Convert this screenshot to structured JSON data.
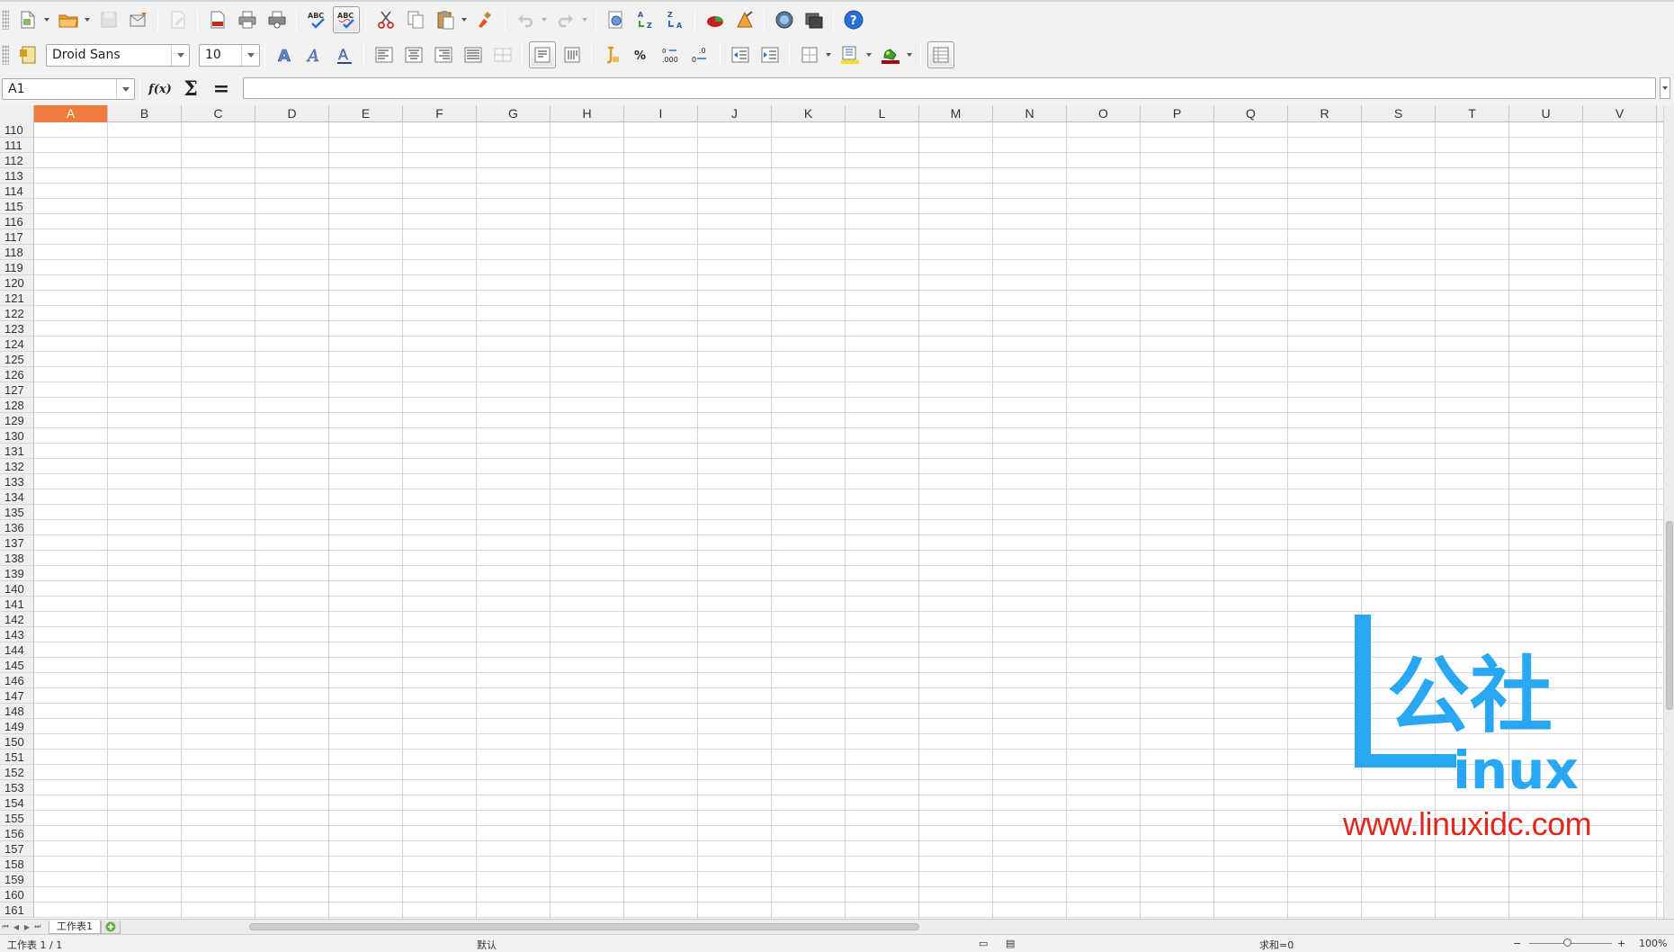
{
  "app": {
    "name_box": "A1",
    "formula": ""
  },
  "toolbar1": {
    "icons": [
      "new-document-icon",
      "open-folder-icon",
      "save-icon",
      "email-icon",
      "edit-mode-icon",
      "export-pdf-icon",
      "print-icon",
      "print-preview-icon",
      "spellcheck-icon",
      "autospellcheck-icon",
      "cut-icon",
      "copy-icon",
      "paste-icon",
      "clone-formatting-icon",
      "undo-icon",
      "redo-icon",
      "navigator-icon",
      "sort-ascending-icon",
      "sort-descending-icon",
      "chart-icon",
      "draw-icon",
      "gallery-icon",
      "data-sources-icon",
      "help-icon"
    ]
  },
  "toolbar2": {
    "font_name": "Droid Sans",
    "font_size": "10",
    "percent_label": "%",
    "decimal_label": ".000",
    "del_decimal_label": ".0"
  },
  "formula_bar": {
    "func_label": "f(x)",
    "sum_label": "Σ",
    "equals_label": "="
  },
  "columns": [
    "A",
    "B",
    "C",
    "D",
    "E",
    "F",
    "G",
    "H",
    "I",
    "J",
    "K",
    "L",
    "M",
    "N",
    "O",
    "P",
    "Q",
    "R",
    "S",
    "T",
    "U",
    "V"
  ],
  "rows": [
    "110",
    "111",
    "112",
    "113",
    "114",
    "115",
    "116",
    "117",
    "118",
    "119",
    "120",
    "121",
    "122",
    "123",
    "124",
    "125",
    "126",
    "127",
    "128",
    "129",
    "130",
    "131",
    "132",
    "133",
    "134",
    "135",
    "136",
    "137",
    "138",
    "139",
    "140",
    "141",
    "142",
    "143",
    "144",
    "145",
    "146",
    "147",
    "148",
    "149",
    "150",
    "151",
    "152",
    "153",
    "154",
    "155",
    "156",
    "157",
    "158",
    "159",
    "160",
    "161"
  ],
  "selected_column": "A",
  "sheets": [
    {
      "label": "工作表1"
    }
  ],
  "status": {
    "sheet_info": "工作表 1 / 1",
    "page_style": "默认",
    "sum": "求和=0",
    "zoom": "100%"
  },
  "watermark": {
    "text": "公社",
    "linux": "inux",
    "url": "www.linuxidc.com"
  },
  "colors": {
    "selected_header": "#f07c3f",
    "watermark_blue": "#2aa7f2",
    "watermark_red": "#e0281e"
  }
}
